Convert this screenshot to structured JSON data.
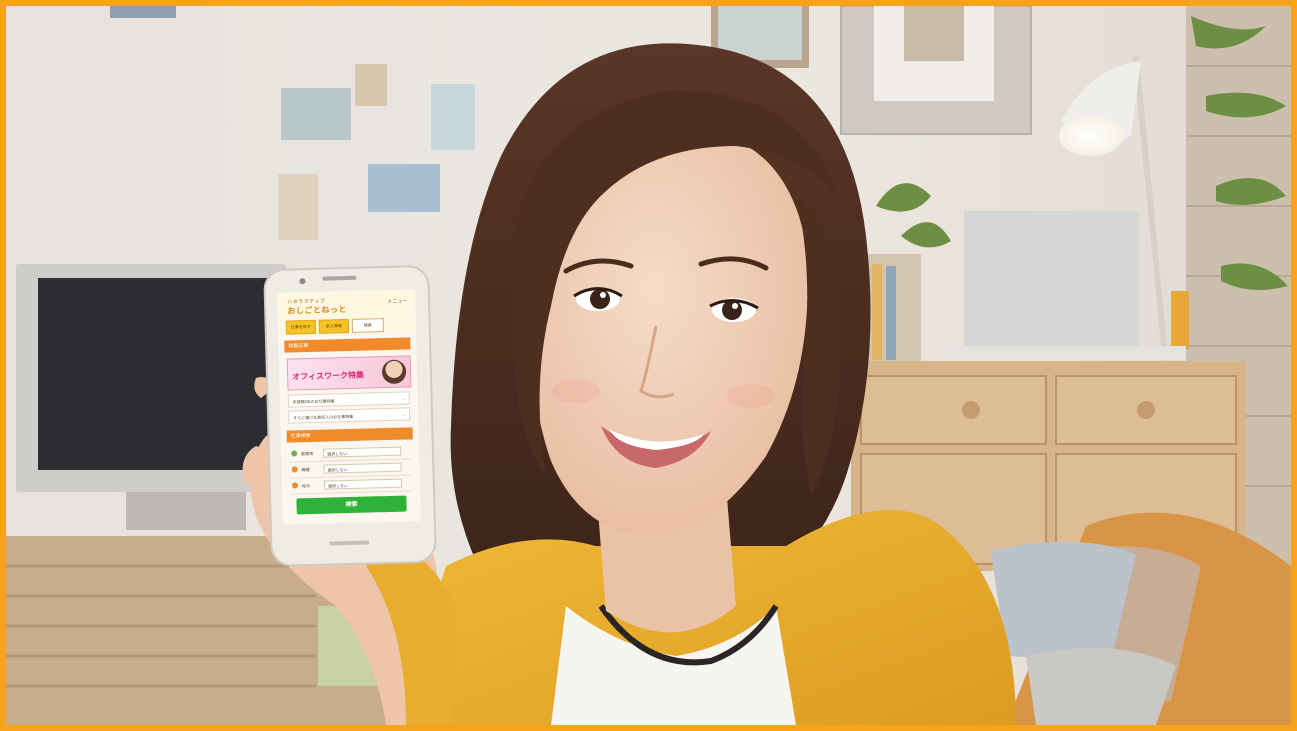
{
  "scene": {
    "colors": {
      "frame": "#f7a21b",
      "cardigan": "#e8ad2e",
      "hair": "#4a2c1d",
      "wall": "#e9e3dc",
      "dresser": "#d8b48a",
      "sofa": "#d99546"
    }
  },
  "phone": {
    "brand": "おしごとねっと",
    "brand_sub": "ハタラクティブ",
    "menu": "メニュー",
    "tabs": [
      "仕事を探す",
      "求人情報",
      "検索"
    ],
    "section1": "特集記事",
    "banner": "オフィスワーク特集",
    "links": [
      "未経験OKのお仕事特集",
      "すぐに働ける高収入のお仕事特集"
    ],
    "section2": "仕事検索",
    "rows": [
      {
        "label": "勤務地",
        "value": "選択しない"
      },
      {
        "label": "職種",
        "value": "選択しない"
      },
      {
        "label": "給与",
        "value": "選択しない"
      }
    ],
    "search_button": "検索"
  }
}
